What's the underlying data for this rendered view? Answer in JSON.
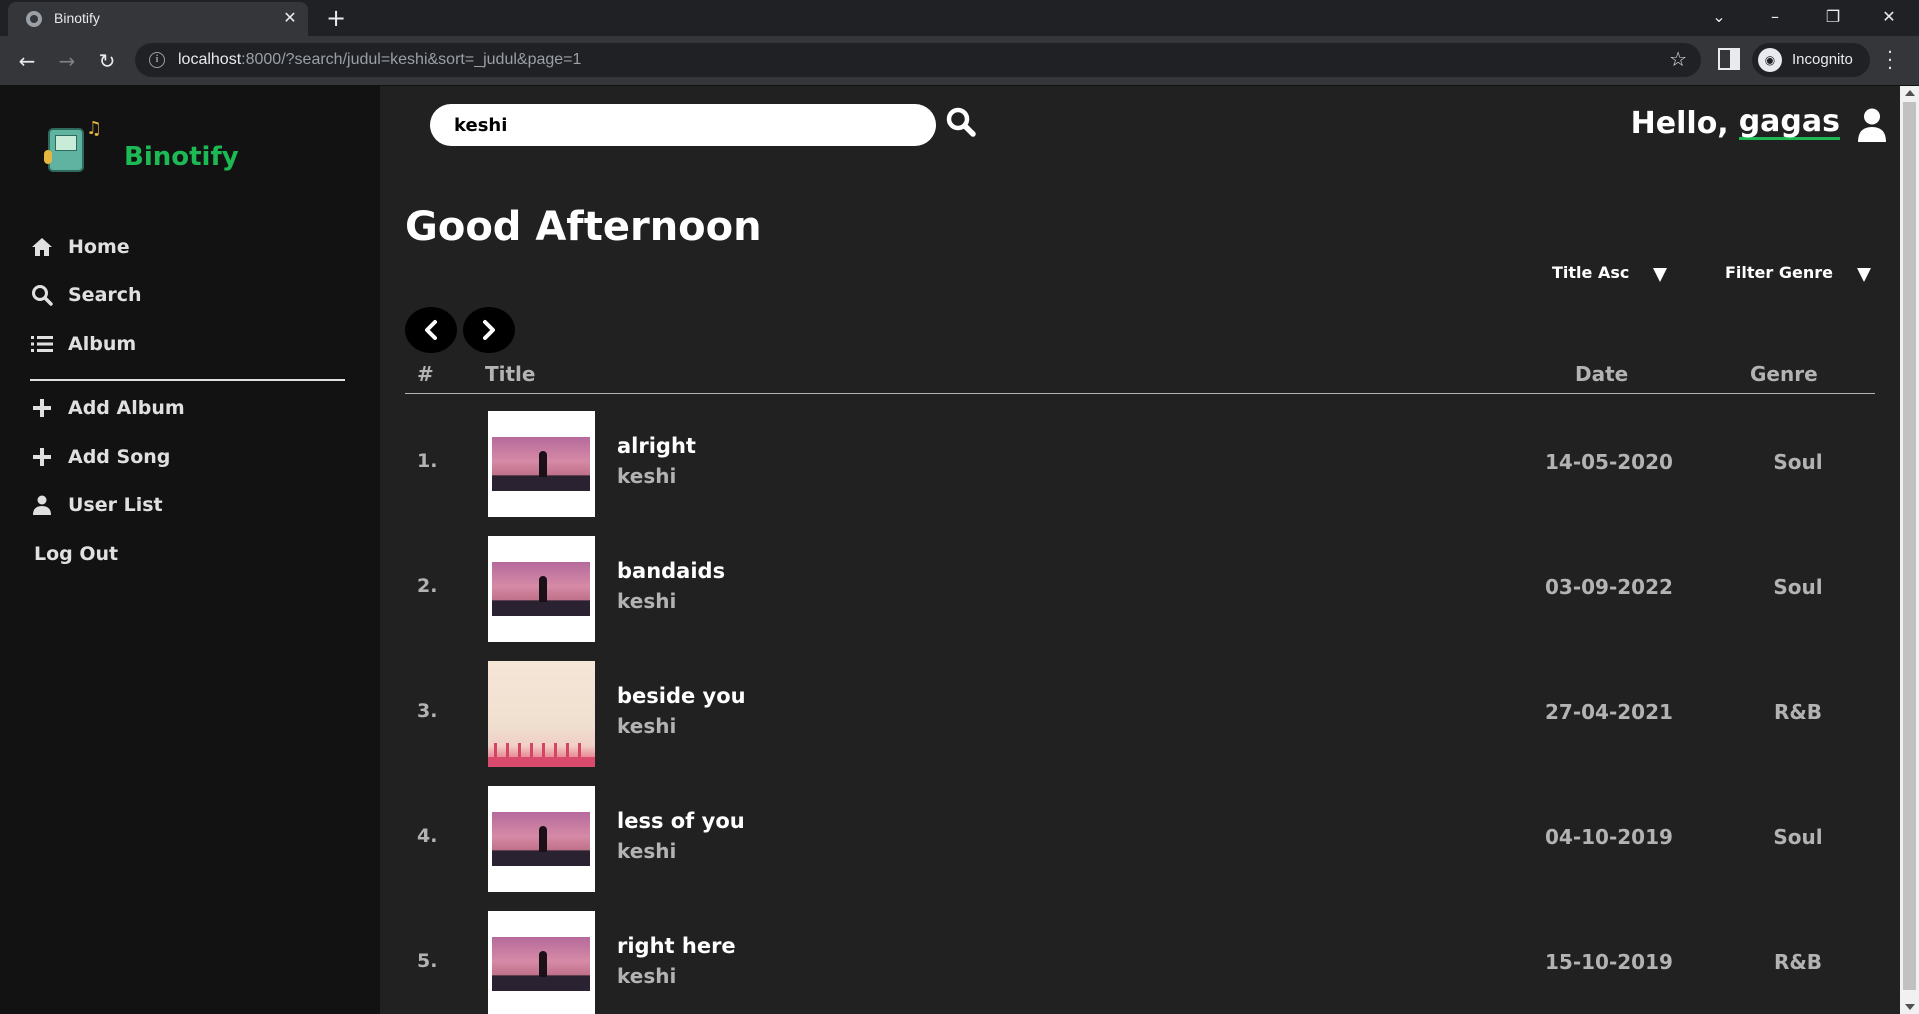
{
  "browser": {
    "tab_title": "Binotify",
    "url_host": "localhost",
    "url_rest": ":8000/?search/judul=keshi&sort=_judul&page=1",
    "profile_label": "Incognito",
    "window_controls": [
      "⌄",
      "–",
      "❐",
      "✕"
    ]
  },
  "sidebar": {
    "logo_text": "Binotify",
    "nav": [
      {
        "label": "Home",
        "icon": "home-icon"
      },
      {
        "label": "Search",
        "icon": "search-icon"
      },
      {
        "label": "Album",
        "icon": "list-icon"
      }
    ],
    "actions": [
      {
        "label": "Add Album",
        "icon": "plus-icon"
      },
      {
        "label": "Add Song",
        "icon": "plus-icon"
      },
      {
        "label": "User List",
        "icon": "user-icon"
      },
      {
        "label": "Log Out"
      }
    ]
  },
  "search": {
    "value": "keshi"
  },
  "header": {
    "greeting": "Hello,",
    "username": "gagas"
  },
  "main": {
    "heading": "Good Afternoon",
    "sort_label": "Title Asc",
    "filter_label": "Filter Genre"
  },
  "table": {
    "columns": {
      "num": "#",
      "title": "Title",
      "date": "Date",
      "genre": "Genre"
    },
    "rows": [
      {
        "num": "1.",
        "title": "alright",
        "artist": "keshi",
        "date": "14-05-2020",
        "genre": "Soul",
        "cover": "sunset"
      },
      {
        "num": "2.",
        "title": "bandaids",
        "artist": "keshi",
        "date": "03-09-2022",
        "genre": "Soul",
        "cover": "sunset"
      },
      {
        "num": "3.",
        "title": "beside you",
        "artist": "keshi",
        "date": "27-04-2021",
        "genre": "R&B",
        "cover": "palms"
      },
      {
        "num": "4.",
        "title": "less of you",
        "artist": "keshi",
        "date": "04-10-2019",
        "genre": "Soul",
        "cover": "sunset"
      },
      {
        "num": "5.",
        "title": "right here",
        "artist": "keshi",
        "date": "15-10-2019",
        "genre": "R&B",
        "cover": "sunset"
      }
    ]
  },
  "colors": {
    "accent": "#1db954",
    "sidebar_bg": "#121212",
    "main_bg": "#212121"
  }
}
